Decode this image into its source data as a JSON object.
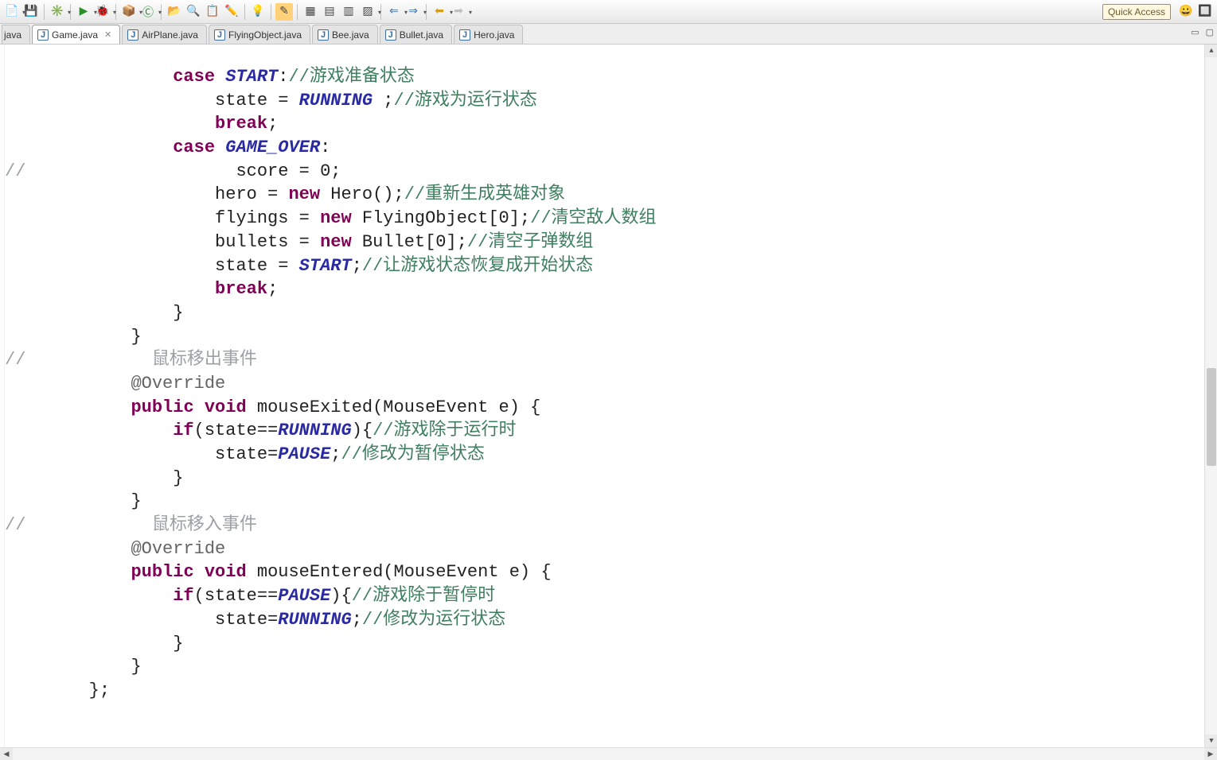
{
  "toolbar": {
    "quick_access": "Quick Access"
  },
  "tabs": {
    "partial_left": "java",
    "items": [
      {
        "label": "Game.java",
        "active": true,
        "closeable": true
      },
      {
        "label": "AirPlane.java",
        "active": false,
        "closeable": false
      },
      {
        "label": "FlyingObject.java",
        "active": false,
        "closeable": false
      },
      {
        "label": "Bee.java",
        "active": false,
        "closeable": false
      },
      {
        "label": "Bullet.java",
        "active": false,
        "closeable": false
      },
      {
        "label": "Hero.java",
        "active": false,
        "closeable": false
      }
    ]
  },
  "code": {
    "lines": [
      {
        "i": "4",
        "t": [
          {
            "c": "kw",
            "v": "case"
          },
          {
            "c": "",
            "v": " "
          },
          {
            "c": "const",
            "v": "START"
          },
          {
            "c": "",
            "v": ":"
          },
          {
            "c": "cmt",
            "v": "//游戏准备状态"
          }
        ]
      },
      {
        "i": "5",
        "t": [
          {
            "c": "",
            "v": "state = "
          },
          {
            "c": "const",
            "v": "RUNNING"
          },
          {
            "c": "",
            "v": " ;"
          },
          {
            "c": "cmt",
            "v": "//游戏为运行状态"
          }
        ]
      },
      {
        "i": "5",
        "t": [
          {
            "c": "kw",
            "v": "break"
          },
          {
            "c": "",
            "v": ";"
          }
        ]
      },
      {
        "i": "4",
        "t": [
          {
            "c": "kw",
            "v": "case"
          },
          {
            "c": "",
            "v": " "
          },
          {
            "c": "const",
            "v": "GAME_OVER"
          },
          {
            "c": "",
            "v": ":"
          }
        ]
      },
      {
        "i": "0",
        "gutter": "//",
        "t": [
          {
            "c": "",
            "v": "                    score = 0;"
          }
        ]
      },
      {
        "i": "5",
        "t": [
          {
            "c": "",
            "v": "hero = "
          },
          {
            "c": "kw",
            "v": "new"
          },
          {
            "c": "",
            "v": " Hero();"
          },
          {
            "c": "cmt",
            "v": "//重新生成英雄对象"
          }
        ]
      },
      {
        "i": "5",
        "t": [
          {
            "c": "",
            "v": "flyings = "
          },
          {
            "c": "kw",
            "v": "new"
          },
          {
            "c": "",
            "v": " FlyingObject[0];"
          },
          {
            "c": "cmt",
            "v": "//清空敌人数组"
          }
        ]
      },
      {
        "i": "5",
        "t": [
          {
            "c": "",
            "v": "bullets = "
          },
          {
            "c": "kw",
            "v": "new"
          },
          {
            "c": "",
            "v": " Bullet[0];"
          },
          {
            "c": "cmt",
            "v": "//清空子弹数组"
          }
        ]
      },
      {
        "i": "5",
        "t": [
          {
            "c": "",
            "v": "state = "
          },
          {
            "c": "const",
            "v": "START"
          },
          {
            "c": "",
            "v": ";"
          },
          {
            "c": "cmt",
            "v": "//让游戏状态恢复成开始状态"
          }
        ]
      },
      {
        "i": "5",
        "t": [
          {
            "c": "kw",
            "v": "break"
          },
          {
            "c": "",
            "v": ";"
          }
        ]
      },
      {
        "i": "4",
        "t": [
          {
            "c": "",
            "v": "}"
          }
        ]
      },
      {
        "i": "3",
        "t": [
          {
            "c": "",
            "v": "}"
          }
        ]
      },
      {
        "i": "0",
        "gutter": "//",
        "t": [
          {
            "c": "cmt-gray",
            "v": "            鼠标移出事件"
          }
        ]
      },
      {
        "i": "3",
        "t": [
          {
            "c": "ann",
            "v": "@Override"
          }
        ]
      },
      {
        "i": "3",
        "t": [
          {
            "c": "kw",
            "v": "public"
          },
          {
            "c": "",
            "v": " "
          },
          {
            "c": "kw",
            "v": "void"
          },
          {
            "c": "",
            "v": " mouseExited(MouseEvent e) {"
          }
        ]
      },
      {
        "i": "4",
        "t": [
          {
            "c": "kw",
            "v": "if"
          },
          {
            "c": "",
            "v": "(state=="
          },
          {
            "c": "const",
            "v": "RUNNING"
          },
          {
            "c": "",
            "v": "){"
          },
          {
            "c": "cmt",
            "v": "//游戏除于运行时"
          }
        ]
      },
      {
        "i": "5",
        "t": [
          {
            "c": "",
            "v": "state="
          },
          {
            "c": "const",
            "v": "PAUSE"
          },
          {
            "c": "",
            "v": ";"
          },
          {
            "c": "cmt",
            "v": "//修改为暂停状态"
          }
        ]
      },
      {
        "i": "4",
        "t": [
          {
            "c": "",
            "v": "}"
          }
        ]
      },
      {
        "i": "3",
        "t": [
          {
            "c": "",
            "v": "}"
          }
        ]
      },
      {
        "i": "0",
        "gutter": "//",
        "t": [
          {
            "c": "cmt-gray",
            "v": "            鼠标移入事件"
          }
        ]
      },
      {
        "i": "3",
        "t": [
          {
            "c": "ann",
            "v": "@Override"
          }
        ]
      },
      {
        "i": "3",
        "t": [
          {
            "c": "kw",
            "v": "public"
          },
          {
            "c": "",
            "v": " "
          },
          {
            "c": "kw",
            "v": "void"
          },
          {
            "c": "",
            "v": " mouseEntered(MouseEvent e) {"
          }
        ]
      },
      {
        "i": "4",
        "t": [
          {
            "c": "kw",
            "v": "if"
          },
          {
            "c": "",
            "v": "(state=="
          },
          {
            "c": "const",
            "v": "PAUSE"
          },
          {
            "c": "",
            "v": "){"
          },
          {
            "c": "cmt",
            "v": "//游戏除于暂停时"
          }
        ]
      },
      {
        "i": "5",
        "t": [
          {
            "c": "",
            "v": "state="
          },
          {
            "c": "const",
            "v": "RUNNING"
          },
          {
            "c": "",
            "v": ";"
          },
          {
            "c": "cmt",
            "v": "//修改为运行状态"
          }
        ]
      },
      {
        "i": "4",
        "t": [
          {
            "c": "",
            "v": "}"
          }
        ]
      },
      {
        "i": "3",
        "t": [
          {
            "c": "",
            "v": "}"
          }
        ]
      },
      {
        "i": "2",
        "t": [
          {
            "c": "",
            "v": "};"
          }
        ]
      }
    ],
    "indent_unit": "    "
  },
  "scroll": {
    "v_thumb_top_pct": 46,
    "v_thumb_height_pct": 14
  }
}
